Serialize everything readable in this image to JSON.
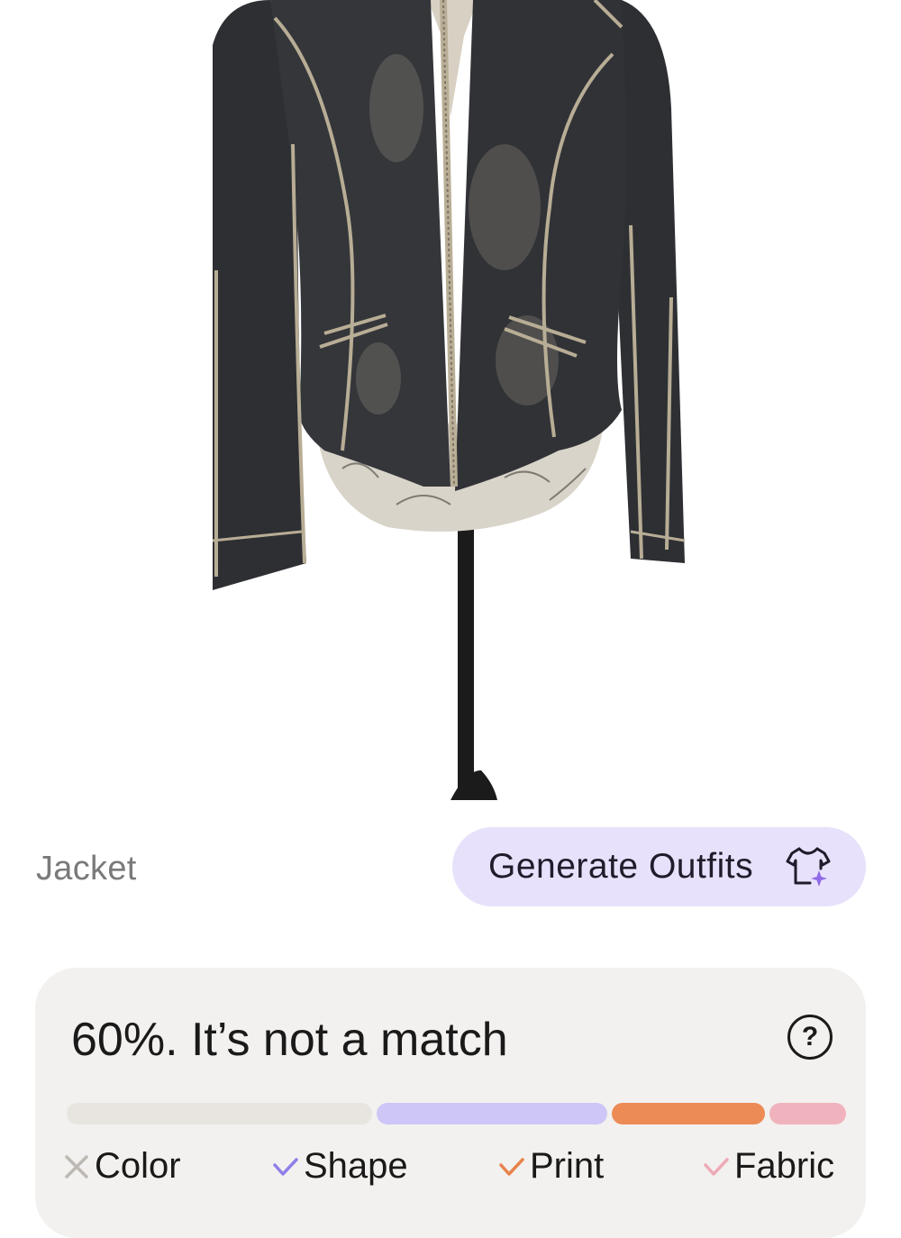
{
  "item": {
    "type_label": "Jacket"
  },
  "actions": {
    "generate_label": "Generate Outfits"
  },
  "match": {
    "title": "60%. It’s not a match",
    "help_symbol": "?",
    "percent": 60,
    "attributes": [
      {
        "label": "Color",
        "matched": false,
        "bar_color": "#e8e5e1",
        "mark_color": "#bdb8b3"
      },
      {
        "label": "Shape",
        "matched": true,
        "bar_color": "#cdc6f6",
        "mark_color": "#8f80e8"
      },
      {
        "label": "Print",
        "matched": true,
        "bar_color": "#ec8b55",
        "mark_color": "#e7834c"
      },
      {
        "label": "Fabric",
        "matched": true,
        "bar_color": "#f0b3bd",
        "mark_color": "#eeaab5"
      }
    ]
  },
  "colors": {
    "accent_button_bg": "#e8e1fb",
    "card_bg": "#f3f1ef",
    "icon_sparkle": "#8f6be8"
  }
}
